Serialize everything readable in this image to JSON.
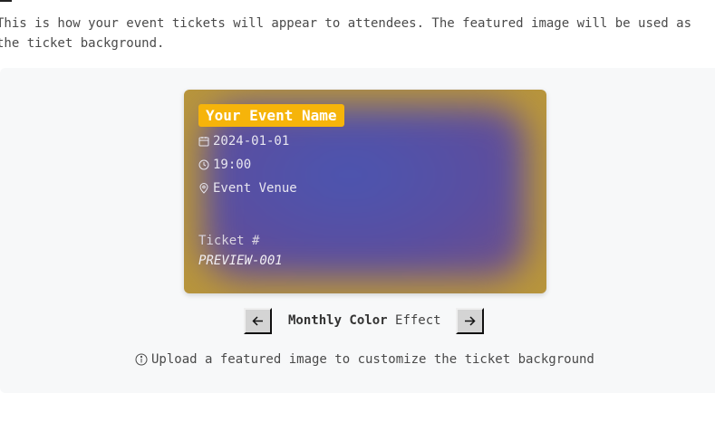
{
  "intro_text": "This is how your event tickets will appear to attendees. The featured image will be used as the ticket background.",
  "ticket": {
    "event_name": "Your Event Name",
    "date": "2024-01-01",
    "time": "19:00",
    "venue": "Event Venue",
    "ticket_label": "Ticket #",
    "ticket_number": "PREVIEW-001",
    "accent_color": "#f6b40a",
    "background_color": "#b8953c"
  },
  "effect": {
    "name_bold": "Monthly Color",
    "name_rest": "Effect",
    "prev_icon": "arrow-left-icon",
    "next_icon": "arrow-right-icon"
  },
  "hint": {
    "icon": "info-icon",
    "text": "Upload a featured image to customize the ticket background"
  }
}
